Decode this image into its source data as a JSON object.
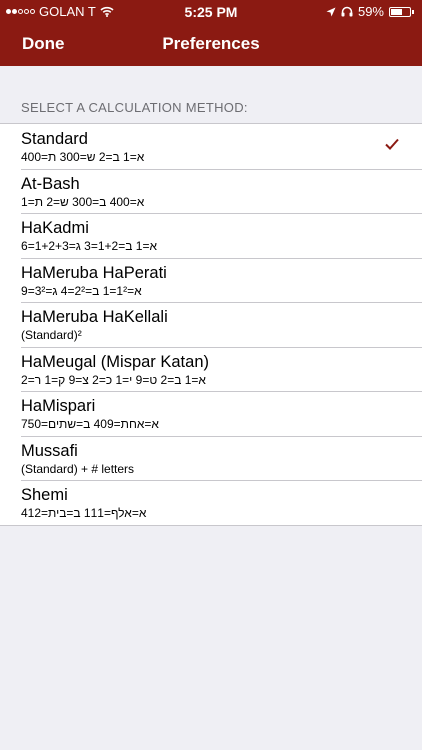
{
  "status_bar": {
    "carrier": "GOLAN T",
    "time": "5:25 PM",
    "battery": "59%",
    "battery_level": 0.59,
    "signal_bars_filled": 2,
    "signal_bars_total": 5
  },
  "nav": {
    "done_label": "Done",
    "title": "Preferences"
  },
  "section_header": "SELECT A CALCULATION METHOD:",
  "accent_color": "#8b1a12",
  "selected_index": 0,
  "methods": [
    {
      "title": "Standard",
      "subtitle": "א=1 ב=2 ש=300 ת=400"
    },
    {
      "title": "At-Bash",
      "subtitle": "א=400 ב=300 ש=2 ת=1"
    },
    {
      "title": "HaKadmi",
      "subtitle": "א=1 ב=1+2=3 ג=1+2+3=6"
    },
    {
      "title": "HaMeruba HaPerati",
      "subtitle": "א=1²=1 ב=2²=4 ג=3²=9"
    },
    {
      "title": "HaMeruba HaKellali",
      "subtitle": "(Standard)²"
    },
    {
      "title": "HaMeugal (Mispar Katan)",
      "subtitle": "א=1 ב=2 ט=9 י=1 כ=2 צ=9 ק=1 ר=2"
    },
    {
      "title": "HaMispari",
      "subtitle": "א=אחת=409 ב=שתים=750"
    },
    {
      "title": "Mussafi",
      "subtitle": "(Standard) + # letters"
    },
    {
      "title": "Shemi",
      "subtitle": "א=אלף=111 ב=בית=412"
    }
  ]
}
